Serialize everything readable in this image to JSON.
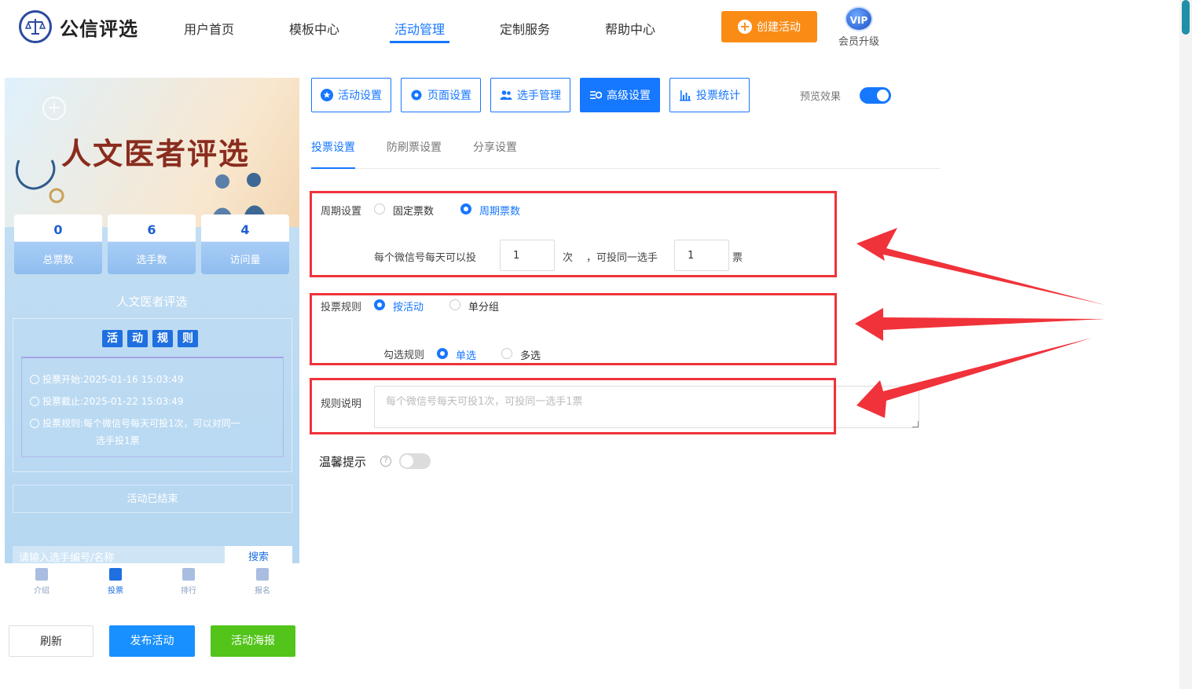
{
  "header": {
    "logo_text": "公信评选",
    "nav": [
      {
        "label": "用户首页",
        "active": false
      },
      {
        "label": "模板中心",
        "active": false
      },
      {
        "label": "活动管理",
        "active": true
      },
      {
        "label": "定制服务",
        "active": false
      },
      {
        "label": "帮助中心",
        "active": false
      }
    ],
    "create_label": "创建活动",
    "vip_badge": "VIP",
    "vip_label": "会员升级"
  },
  "preview": {
    "banner_title": "人文医者评选",
    "stats": [
      {
        "value": "0",
        "label": "总票数"
      },
      {
        "value": "6",
        "label": "选手数"
      },
      {
        "value": "4",
        "label": "访问量"
      }
    ],
    "activity_name": "人文医者评选",
    "rules_title": [
      "活",
      "动",
      "规",
      "则"
    ],
    "rules": [
      {
        "label": "投票开始:",
        "value": "2025-01-16 15:03:49"
      },
      {
        "label": "投票截止:",
        "value": "2025-01-22 15:03:49"
      },
      {
        "label": "投票规则:",
        "value": "每个微信号每天可投1次，可以对同一"
      },
      {
        "label": "",
        "value": "选手投1票"
      }
    ],
    "ended": "活动已结束",
    "search_placeholder": "请输入选手编号/名称",
    "search_btn": "搜索",
    "tabs": [
      {
        "label": "介绍",
        "active": false
      },
      {
        "label": "投票",
        "active": true
      },
      {
        "label": "排行",
        "active": false
      },
      {
        "label": "报名",
        "active": false
      }
    ]
  },
  "actions": {
    "refresh": "刷新",
    "publish": "发布活动",
    "poster": "活动海报"
  },
  "toolbar": {
    "buttons": [
      {
        "label": "活动设置",
        "active": false
      },
      {
        "label": "页面设置",
        "active": false
      },
      {
        "label": "选手管理",
        "active": false
      },
      {
        "label": "高级设置",
        "active": true
      },
      {
        "label": "投票统计",
        "active": false
      }
    ],
    "preview_label": "预览效果",
    "preview_on": true
  },
  "subtabs": [
    {
      "label": "投票设置",
      "active": true
    },
    {
      "label": "防刷票设置",
      "active": false
    },
    {
      "label": "分享设置",
      "active": false
    }
  ],
  "form": {
    "period": {
      "label": "周期设置",
      "option_fixed": "固定票数",
      "option_period": "周期票数",
      "selected": "周期票数",
      "sentence_a": "每个微信号每天可以投",
      "times_value": "1",
      "unit_times": "次",
      "sentence_b": "，可投同一选手",
      "votes_value": "1",
      "unit_votes": "票"
    },
    "rule": {
      "label": "投票规则",
      "option_activity": "按活动",
      "option_group": "单分组",
      "selected": "按活动",
      "check_label": "勾选规则",
      "option_single": "单选",
      "option_multi": "多选",
      "check_selected": "单选"
    },
    "desc": {
      "label": "规则说明",
      "placeholder": "每个微信号每天可投1次，可投同一选手1票"
    },
    "tip": {
      "label": "温馨提示",
      "enabled": false
    }
  },
  "colors": {
    "primary": "#1677ff",
    "orange": "#fa8c16",
    "green": "#52c41a",
    "highlight": "#f0323a"
  }
}
